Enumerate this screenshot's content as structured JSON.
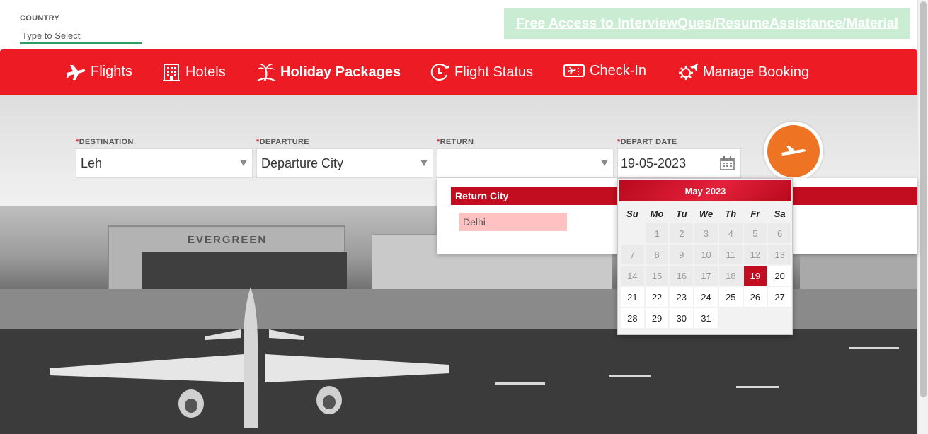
{
  "country": {
    "label": "COUNTRY",
    "placeholder": "Type to Select"
  },
  "promo": {
    "text": "Free Access to InterviewQues/ResumeAssistance/Material"
  },
  "nav": {
    "items": [
      {
        "label": "Flights",
        "icon": "plane-icon"
      },
      {
        "label": "Hotels",
        "icon": "building-icon"
      },
      {
        "label": "Holiday Packages",
        "icon": "palm-tree-icon",
        "active": true
      },
      {
        "label": "Flight Status",
        "icon": "clock-plane-icon"
      },
      {
        "label": "Check-In",
        "icon": "ticket-icon"
      },
      {
        "label": "Manage Booking",
        "icon": "gear-plane-icon"
      }
    ]
  },
  "form": {
    "destination": {
      "label": "DESTINATION",
      "value": "Leh"
    },
    "departure": {
      "label": "DEPARTURE",
      "value": "Departure City"
    },
    "return": {
      "label": "RETURN",
      "value": ""
    },
    "depart_date": {
      "label": "DEPART DATE",
      "value": "19-05-2023"
    }
  },
  "return_dropdown": {
    "header": "Return City",
    "options": [
      "Delhi"
    ]
  },
  "hero": {
    "hangar_text": "EVERGREEN"
  },
  "datepicker": {
    "title": "May 2023",
    "weekdays": [
      "Su",
      "Mo",
      "Tu",
      "We",
      "Th",
      "Fr",
      "Sa"
    ],
    "weeks": [
      [
        "",
        "1",
        "2",
        "3",
        "4",
        "5",
        "6"
      ],
      [
        "7",
        "8",
        "9",
        "10",
        "11",
        "12",
        "13"
      ],
      [
        "14",
        "15",
        "16",
        "17",
        "18",
        "19",
        "20"
      ],
      [
        "21",
        "22",
        "23",
        "24",
        "25",
        "26",
        "27"
      ],
      [
        "28",
        "29",
        "30",
        "31",
        "",
        "",
        ""
      ]
    ],
    "selected": "19",
    "first_available": "19"
  },
  "colors": {
    "brand_red": "#ed1c24",
    "accent_orange": "#ee7322",
    "selected_red": "#c10d1f",
    "promo_bg": "#c9ecd3"
  }
}
